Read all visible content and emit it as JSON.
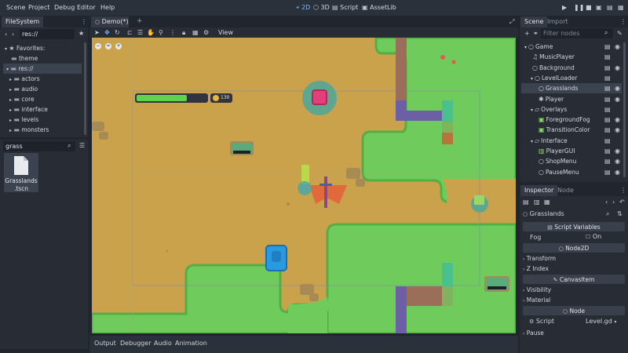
{
  "menu": {
    "items": [
      "Scene",
      "Project",
      "Debug",
      "Editor",
      "Help"
    ],
    "workspaces": [
      "2D",
      "3D",
      "Script",
      "AssetLib"
    ],
    "active_workspace": "2D"
  },
  "filesystem": {
    "tab": "FileSystem",
    "path": "res://",
    "favorites_label": "Favorites:",
    "favorites": [
      "theme"
    ],
    "root": "res://",
    "folders": [
      "actors",
      "audio",
      "core",
      "interface",
      "levels",
      "monsters"
    ],
    "search_value": "grass",
    "file_name": "Grasslands",
    "file_ext": ".tscn"
  },
  "editor": {
    "tab": "Demo(*)",
    "add_tab": "+",
    "view_menu": "View"
  },
  "hud": {
    "coin_count": "130",
    "health_fraction": 0.72
  },
  "bottom_panel": {
    "tabs": [
      "Output",
      "Debugger",
      "Audio",
      "Animation"
    ]
  },
  "scene_dock": {
    "tabs": [
      "Scene",
      "Import"
    ],
    "filter_placeholder": "Filter nodes",
    "nodes": [
      {
        "label": "Game",
        "depth": 0,
        "kind": "node2d"
      },
      {
        "label": "MusicPlayer",
        "depth": 1,
        "kind": "audio"
      },
      {
        "label": "Background",
        "depth": 1,
        "kind": "node2d"
      },
      {
        "label": "LevelLoader",
        "depth": 1,
        "kind": "node2d"
      },
      {
        "label": "Grasslands",
        "depth": 2,
        "kind": "node2d",
        "selected": true
      },
      {
        "label": "Player",
        "depth": 2,
        "kind": "player"
      },
      {
        "label": "Overlays",
        "depth": 1,
        "kind": "folder"
      },
      {
        "label": "ForegroundFog",
        "depth": 2,
        "kind": "color"
      },
      {
        "label": "TransitionColor",
        "depth": 2,
        "kind": "color"
      },
      {
        "label": "Interface",
        "depth": 1,
        "kind": "folder"
      },
      {
        "label": "PlayerGUI",
        "depth": 2,
        "kind": "gui"
      },
      {
        "label": "ShopMenu",
        "depth": 2,
        "kind": "node2d"
      },
      {
        "label": "PauseMenu",
        "depth": 2,
        "kind": "node2d"
      }
    ]
  },
  "inspector": {
    "tabs": [
      "Inspector",
      "Node"
    ],
    "object_name": "Grasslands",
    "script_variables": "Script Variables",
    "fog_label": "Fog",
    "fog_value": "On",
    "node2d_header": "Node2D",
    "transform": "Transform",
    "z_index": "Z Index",
    "canvasitem_header": "CanvasItem",
    "visibility": "Visibility",
    "material": "Material",
    "node_header": "Node",
    "script_label": "Script",
    "script_value": "Level.gd",
    "pause": "Pause"
  },
  "colors": {
    "accent": "#7fb6ff",
    "grass": "#6ecb5c",
    "dirt": "#caa24c",
    "health": "#5fd34a"
  }
}
